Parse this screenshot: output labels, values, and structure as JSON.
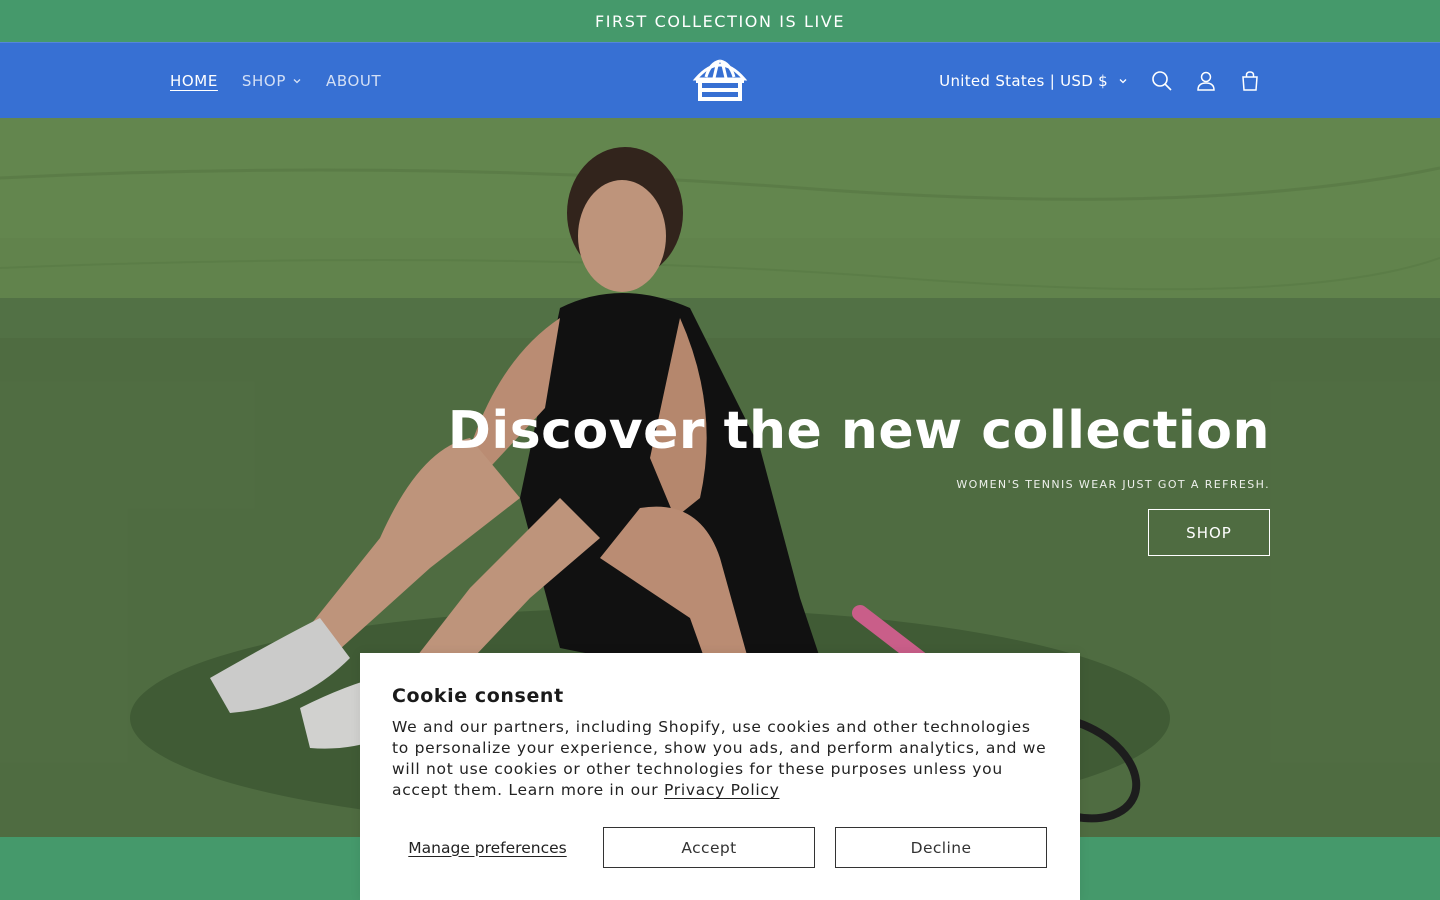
{
  "announcement": {
    "text": "FIRST COLLECTION IS LIVE"
  },
  "nav": {
    "items": [
      {
        "label": "HOME"
      },
      {
        "label": "SHOP"
      },
      {
        "label": "ABOUT"
      }
    ]
  },
  "header": {
    "country": "United States | USD $",
    "icons": [
      "search-icon",
      "account-icon",
      "cart-icon"
    ]
  },
  "hero": {
    "title": "Discover the new collection",
    "subtitle": "WOMEN'S TENNIS WEAR JUST GOT A REFRESH.",
    "button": "SHOP"
  },
  "cookie": {
    "title": "Cookie consent",
    "text": "We and our partners, including Shopify, use cookies and other technologies to personalize your experience, show you ads, and perform analytics, and we will not use cookies or other technologies for these purposes unless you accept them. Learn more in our",
    "link": "Privacy Policy",
    "manage": "Manage preferences",
    "accept": "Accept",
    "decline": "Decline"
  },
  "colors": {
    "announcement_bg": "#45996b",
    "header_bg": "#3770d3",
    "court_green": "#5e7f4e"
  }
}
